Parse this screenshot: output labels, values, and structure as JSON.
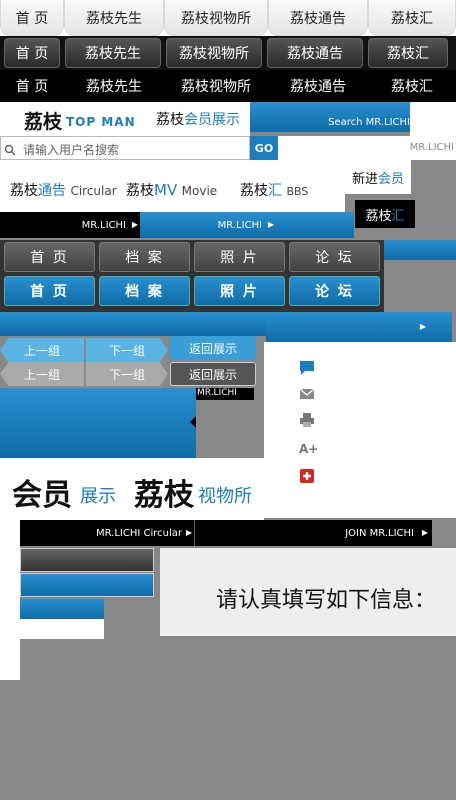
{
  "nav_rows": {
    "r1": [
      "首 页",
      "荔枝先生",
      "荔枝视物所",
      "荔枝通告",
      "荔枝汇"
    ],
    "r2": [
      "首 页",
      "荔枝先生",
      "荔枝视物所",
      "荔枝通告",
      "荔枝汇"
    ],
    "r3": [
      "首 页",
      "荔枝先生",
      "荔枝视物所",
      "荔枝通告",
      "荔枝汇"
    ]
  },
  "header": {
    "logo_cn": "荔枝",
    "logo_en": "TOP MAN",
    "member_prefix": "荔枝",
    "member_suffix": "会员展示",
    "search_tag": "Search MR.LICHI",
    "search_placeholder": "请输入用户名搜索",
    "go_label": "GO",
    "mr_lichi_small": "MR.LICHI"
  },
  "sections": {
    "s1_prefix": "荔枝",
    "s1_blue": "通告",
    "s1_en": "Circular",
    "s2_prefix": "荔枝",
    "s2_blue": "MV",
    "s2_en": "Movie",
    "s3_prefix": "荔枝",
    "s3_blue": "汇",
    "s3_en": "BBS",
    "newbie_prefix": "新进",
    "newbie_blue": "会员",
    "dark_tab_prefix": "荔枝",
    "dark_tab_blue": "汇"
  },
  "mr_bars": {
    "black_label": "MR.LICHI",
    "blue_label": "MR.LICHI"
  },
  "grid_nav": {
    "top": [
      "首 页",
      "档 案",
      "照 片",
      "论 坛"
    ],
    "bottom": [
      "首 页",
      "档 案",
      "照 片",
      "论 坛"
    ]
  },
  "pager": {
    "prev": "上一组",
    "next": "下一组",
    "back": "返回展示",
    "prev2": "上一组",
    "next2": "下一组",
    "back2": "返回展示",
    "mr_tag": "MR.LICHI"
  },
  "side_icons": [
    "chat-icon",
    "mail-icon",
    "print-icon",
    "font-size-icon",
    "add-icon"
  ],
  "side_icon_glyphs": {
    "font": "A+"
  },
  "titles": {
    "big1": "会员",
    "small1": "展示",
    "big2": "荔枝",
    "small2": "视物所"
  },
  "bottom_bars": {
    "left": "MR.LICHI Circular",
    "right": "JOIN MR.LICHI"
  },
  "form_prompt": "请认真填写如下信息："
}
